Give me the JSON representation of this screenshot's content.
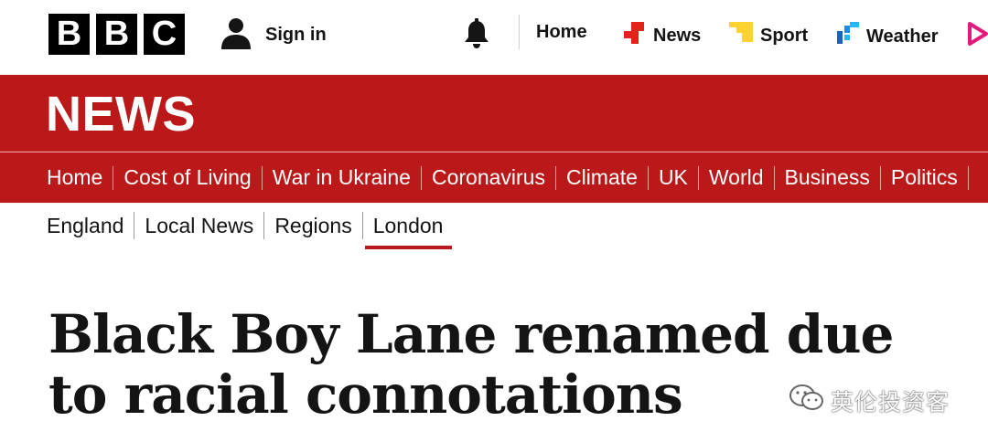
{
  "brand": {
    "logo_letters": [
      "B",
      "B",
      "C"
    ],
    "section_title": "NEWS",
    "accent_color": "#bb1919"
  },
  "account": {
    "sign_in_label": "Sign in",
    "user_icon": "user-icon",
    "notification_icon": "bell-icon"
  },
  "top_nav": [
    {
      "label": "Home",
      "icon": null
    },
    {
      "label": "News",
      "icon": "news-icon",
      "icon_color": "#e2231a"
    },
    {
      "label": "Sport",
      "icon": "sport-icon",
      "icon_color": "#ffd230"
    },
    {
      "label": "Weather",
      "icon": "weather-icon",
      "icon_color": "#1e88e5"
    }
  ],
  "section_nav": [
    {
      "label": "Home"
    },
    {
      "label": "Cost of Living"
    },
    {
      "label": "War in Ukraine"
    },
    {
      "label": "Coronavirus"
    },
    {
      "label": "Climate"
    },
    {
      "label": "UK",
      "active": true
    },
    {
      "label": "World"
    },
    {
      "label": "Business"
    },
    {
      "label": "Politics"
    }
  ],
  "sub_nav": [
    {
      "label": "England"
    },
    {
      "label": "Local News"
    },
    {
      "label": "Regions"
    },
    {
      "label": "London",
      "active": true
    }
  ],
  "article": {
    "headline": "Black Boy Lane renamed due to racial connotations"
  },
  "watermark": {
    "text": "英伦投资客",
    "icon": "wechat-icon"
  }
}
